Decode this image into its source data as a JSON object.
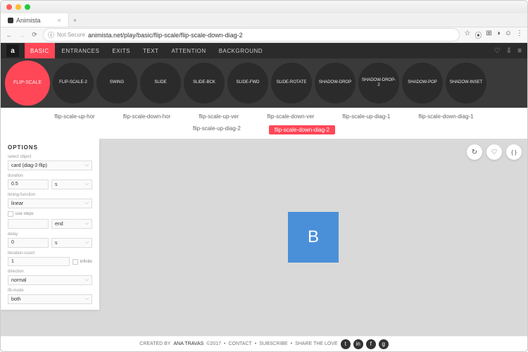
{
  "browser": {
    "tab_title": "Animista",
    "security": "Not Secure",
    "url": "animista.net/play/basic/flip-scale/flip-scale-down-diag-2"
  },
  "nav": {
    "logo": "a",
    "items": [
      "BASIC",
      "ENTRANCES",
      "EXITS",
      "TEXT",
      "ATTENTION",
      "BACKGROUND"
    ],
    "active_index": 0
  },
  "categories": [
    "FLIP-SCALE",
    "FLIP-SCALE-2",
    "SWING",
    "SLIDE",
    "SLIDE-BCK",
    "SLIDE-FWD",
    "SLIDE-ROTATE",
    "SHADOW-DROP",
    "SHADOW-DROP-2",
    "SHADOW-POP",
    "SHADOW-INSET"
  ],
  "active_category_index": 0,
  "variants": {
    "row1": [
      "flip-scale-up-hor",
      "flip-scale-down-hor",
      "flip-scale-up-ver",
      "flip-scale-down-ver",
      "flip-scale-up-diag-1",
      "flip-scale-down-diag-1"
    ],
    "row2": [
      "flip-scale-up-diag-2",
      "flip-scale-down-diag-2"
    ],
    "active": "flip-scale-down-diag-2"
  },
  "options": {
    "title": "OPTIONS",
    "object_label": "select object",
    "object": "card (diag-2-flip)",
    "duration_label": "duration",
    "duration": "0.5",
    "duration_unit": "s",
    "timing_label": "timing-function",
    "timing": "linear",
    "use_steps_label": "use steps",
    "steps_val": "",
    "steps_pos": "end",
    "delay_label": "delay",
    "delay": "0",
    "delay_unit": "s",
    "iteration_label": "iteration-count",
    "iteration": "1",
    "infinite_label": "infinite",
    "direction_label": "direction",
    "direction": "normal",
    "fill_label": "fill-mode",
    "fill": "both"
  },
  "preview": {
    "letter": "B",
    "buttons": {
      "replay": "↻",
      "fav": "♡",
      "code": "{ }"
    }
  },
  "footer": {
    "text1": "CREATED BY",
    "author": "ANA TRAVAS",
    "year": "©2017",
    "contact": "CONTACT",
    "subscribe": "SUBSCRIBE",
    "share": "SHARE THE LOVE",
    "bullet": "•"
  }
}
